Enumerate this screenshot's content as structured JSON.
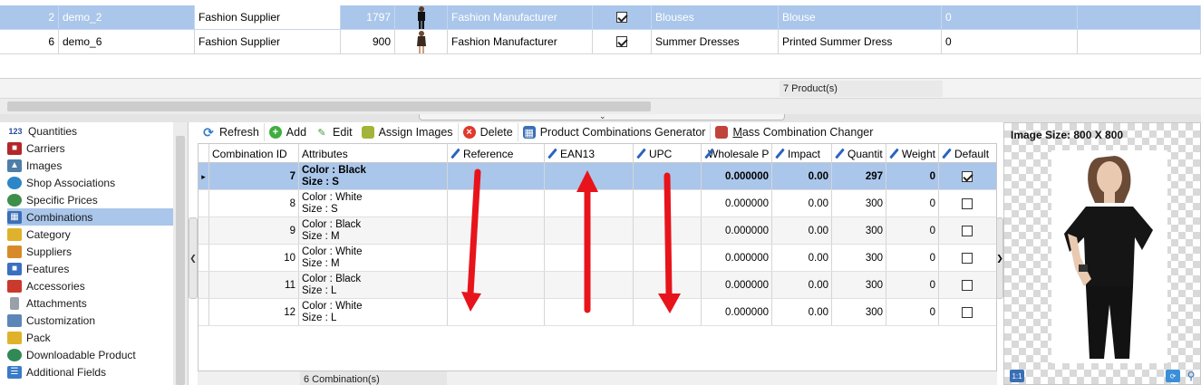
{
  "products": {
    "rows": [
      {
        "id": "2",
        "reference": "demo_2",
        "supplier": "Fashion Supplier",
        "quantity": "1797",
        "manufacturer": "Fashion Manufacturer",
        "active": true,
        "category": "Blouses",
        "name": "Blouse",
        "extra": "0",
        "selected": true
      },
      {
        "id": "6",
        "reference": "demo_6",
        "supplier": "Fashion Supplier",
        "quantity": "900",
        "manufacturer": "Fashion Manufacturer",
        "active": true,
        "category": "Summer Dresses",
        "name": "Printed Summer Dress",
        "extra": "0",
        "selected": false
      }
    ],
    "count_label": "7 Product(s)"
  },
  "nav": {
    "items": [
      {
        "label": "Quantities",
        "icon": "quantities-icon",
        "active": false
      },
      {
        "label": "Carriers",
        "icon": "truck-icon",
        "active": false
      },
      {
        "label": "Images",
        "icon": "image-icon",
        "active": false
      },
      {
        "label": "Shop Associations",
        "icon": "globe-icon",
        "active": false
      },
      {
        "label": "Specific Prices",
        "icon": "price-globe-icon",
        "active": false
      },
      {
        "label": "Combinations",
        "icon": "cubes-icon",
        "active": true
      },
      {
        "label": "Category",
        "icon": "folder-icon",
        "active": false
      },
      {
        "label": "Suppliers",
        "icon": "store-icon",
        "active": false
      },
      {
        "label": "Features",
        "icon": "features-icon",
        "active": false
      },
      {
        "label": "Accessories",
        "icon": "accessories-icon",
        "active": false
      },
      {
        "label": "Attachments",
        "icon": "paperclip-icon",
        "active": false
      },
      {
        "label": "Customization",
        "icon": "customization-icon",
        "active": false
      },
      {
        "label": "Pack",
        "icon": "pack-icon",
        "active": false
      },
      {
        "label": "Downloadable Product",
        "icon": "download-globe-icon",
        "active": false
      },
      {
        "label": "Additional Fields",
        "icon": "fields-icon",
        "active": false
      }
    ]
  },
  "toolbar": {
    "refresh": "Refresh",
    "add": "Add",
    "edit": "Edit",
    "assign_images": "Assign Images",
    "delete": "Delete",
    "generator": "Product Combinations Generator",
    "mass_changer_first": "M",
    "mass_changer_rest": "ass Combination Changer"
  },
  "combinations": {
    "headers": {
      "id": "Combination ID",
      "attributes": "Attributes",
      "reference": "Reference",
      "ean13": "EAN13",
      "upc": "UPC",
      "wholesale": "Wholesale P",
      "impact": "Impact",
      "quantity": "Quantit",
      "weight": "Weight",
      "default": "Default"
    },
    "rows": [
      {
        "id": "7",
        "color": "Color : Black",
        "size": "Size : S",
        "reference": "",
        "ean13": "",
        "upc": "",
        "wholesale": "0.000000",
        "impact": "0.00",
        "quantity": "297",
        "weight": "0",
        "default": true,
        "selected": true
      },
      {
        "id": "8",
        "color": "Color : White",
        "size": "Size : S",
        "reference": "",
        "ean13": "",
        "upc": "",
        "wholesale": "0.000000",
        "impact": "0.00",
        "quantity": "300",
        "weight": "0",
        "default": false,
        "selected": false
      },
      {
        "id": "9",
        "color": "Color : Black",
        "size": "Size : M",
        "reference": "",
        "ean13": "",
        "upc": "",
        "wholesale": "0.000000",
        "impact": "0.00",
        "quantity": "300",
        "weight": "0",
        "default": false,
        "selected": false
      },
      {
        "id": "10",
        "color": "Color : White",
        "size": "Size : M",
        "reference": "",
        "ean13": "",
        "upc": "",
        "wholesale": "0.000000",
        "impact": "0.00",
        "quantity": "300",
        "weight": "0",
        "default": false,
        "selected": false
      },
      {
        "id": "11",
        "color": "Color : Black",
        "size": "Size : L",
        "reference": "",
        "ean13": "",
        "upc": "",
        "wholesale": "0.000000",
        "impact": "0.00",
        "quantity": "300",
        "weight": "0",
        "default": false,
        "selected": false
      },
      {
        "id": "12",
        "color": "Color : White",
        "size": "Size : L",
        "reference": "",
        "ean13": "",
        "upc": "",
        "wholesale": "0.000000",
        "impact": "0.00",
        "quantity": "300",
        "weight": "0",
        "default": false,
        "selected": false
      }
    ],
    "count_label": "6 Combination(s)"
  },
  "preview": {
    "size_label": "Image Size: 800 X 800",
    "zoom_label": "1:1"
  },
  "colors": {
    "selection": "#aac6ea",
    "annotation_arrow": "#e8141b",
    "accent_pen": "#2b63c0"
  }
}
